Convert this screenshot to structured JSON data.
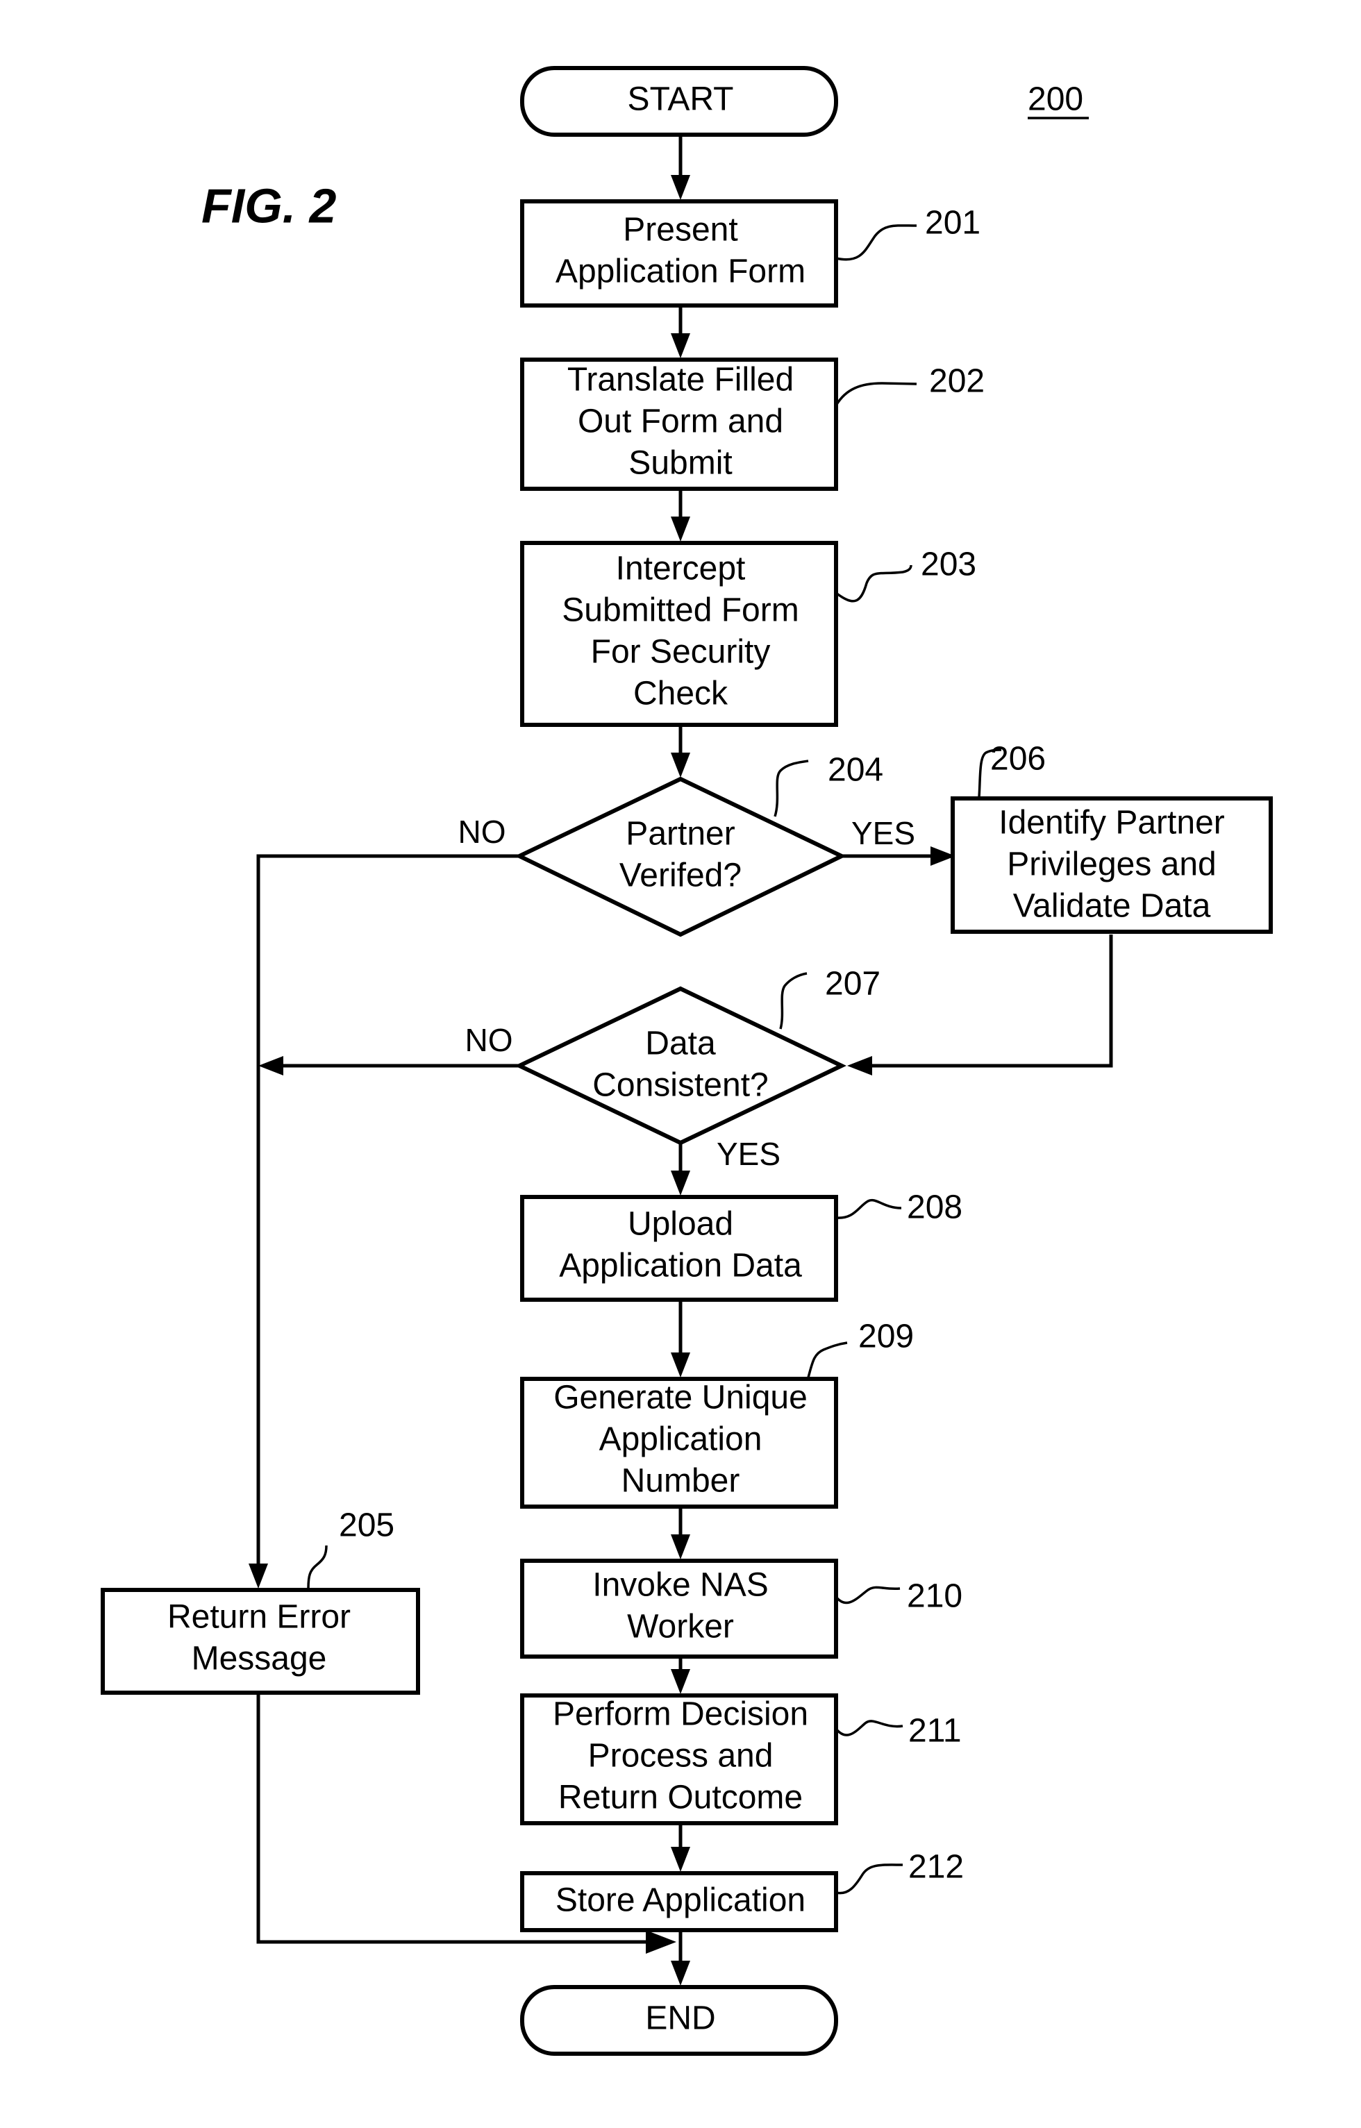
{
  "figure": {
    "title": "FIG. 2",
    "reference": "200"
  },
  "terminals": {
    "start": "START",
    "end": "END"
  },
  "steps": {
    "s201": {
      "ref": "201",
      "lines": [
        "Present",
        "Application Form"
      ]
    },
    "s202": {
      "ref": "202",
      "lines": [
        "Translate Filled",
        "Out Form and",
        "Submit"
      ]
    },
    "s203": {
      "ref": "203",
      "lines": [
        "Intercept",
        "Submitted Form",
        "For Security",
        "Check"
      ]
    },
    "s204": {
      "ref": "204",
      "lines": [
        "Partner",
        "Verifed?"
      ]
    },
    "s205": {
      "ref": "205",
      "lines": [
        "Return Error",
        "Message"
      ]
    },
    "s206": {
      "ref": "206",
      "lines": [
        "Identify Partner",
        "Privileges and",
        "Validate Data"
      ]
    },
    "s207": {
      "ref": "207",
      "lines": [
        "Data",
        "Consistent?"
      ]
    },
    "s208": {
      "ref": "208",
      "lines": [
        "Upload",
        "Application Data"
      ]
    },
    "s209": {
      "ref": "209",
      "lines": [
        "Generate Unique",
        "Application",
        "Number"
      ]
    },
    "s210": {
      "ref": "210",
      "lines": [
        "Invoke NAS",
        "Worker"
      ]
    },
    "s211": {
      "ref": "211",
      "lines": [
        "Perform Decision",
        "Process and",
        "Return Outcome"
      ]
    },
    "s212": {
      "ref": "212",
      "lines": [
        "Store Application"
      ]
    }
  },
  "branch_labels": {
    "d204_no": "NO",
    "d204_yes": "YES",
    "d207_no": "NO",
    "d207_yes": "YES"
  }
}
